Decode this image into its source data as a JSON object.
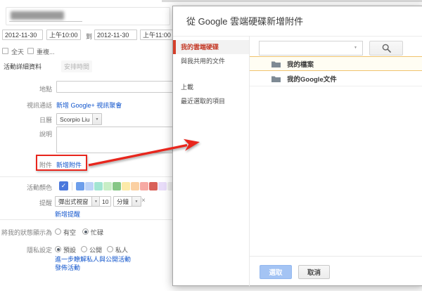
{
  "accent": {
    "annotation_red": "#e8261d",
    "link_blue": "#1155cc",
    "nav_selected_red": "#c43a27",
    "selection_border_yellow": "#f0c36d"
  },
  "form": {
    "start_date": "2012-11-30",
    "start_time": "上午10:00",
    "to_label": "到",
    "end_date": "2012-11-30",
    "end_time": "上午11:00",
    "all_day": "全天",
    "repeat": "重複...",
    "tabs": {
      "details": "活動詳細資料",
      "schedule": "安排時間"
    },
    "location_label": "地點",
    "video_label": "視訊通話",
    "video_link": "新增 Google+ 視訊聚會",
    "calendar_label": "日曆",
    "calendar_value": "Scorpio Liu",
    "description_label": "說明",
    "attachment_label": "附件",
    "attachment_link": "新增附件",
    "color_label": "活動顏色",
    "color_selected": "#4b78dc",
    "color_check": "✓",
    "color_palette": [
      "#6d9eeb",
      "#bdd3f7",
      "#a2e5d2",
      "#c8eec6",
      "#86c786",
      "#fdeaa9",
      "#fbd0a2",
      "#f7aaa4",
      "#d96059",
      "#e8dcf9",
      "#ededed"
    ],
    "reminder_label": "提醒",
    "reminder_method": "彈出式視窗",
    "reminder_value": "10",
    "reminder_unit": "分鐘",
    "reminder_remove": "×",
    "add_reminder": "新增提醒",
    "status_label": "將我的狀態顯示為",
    "status_free": "有空",
    "status_busy": "忙碌",
    "privacy_label": "隱私設定",
    "privacy_default": "預設",
    "privacy_public": "公開",
    "privacy_private": "私人",
    "learn_more": "進一步瞭解私人與公開活動",
    "publish": "發佈活動"
  },
  "dialog": {
    "title": "從 Google 雲端硬碟新增附件",
    "nav": [
      {
        "label": "我的雲端硬碟",
        "selected": true
      },
      {
        "label": "與我共用的文件",
        "selected": false
      },
      {
        "label": "上載",
        "selected": false
      },
      {
        "label": "最近選取的項目",
        "selected": false
      }
    ],
    "search": {
      "value": ""
    },
    "files": [
      {
        "label": "我的檔案",
        "selected": true
      },
      {
        "label": "我的Google文件",
        "selected": false
      }
    ],
    "select_button": "選取",
    "cancel_button": "取消"
  }
}
